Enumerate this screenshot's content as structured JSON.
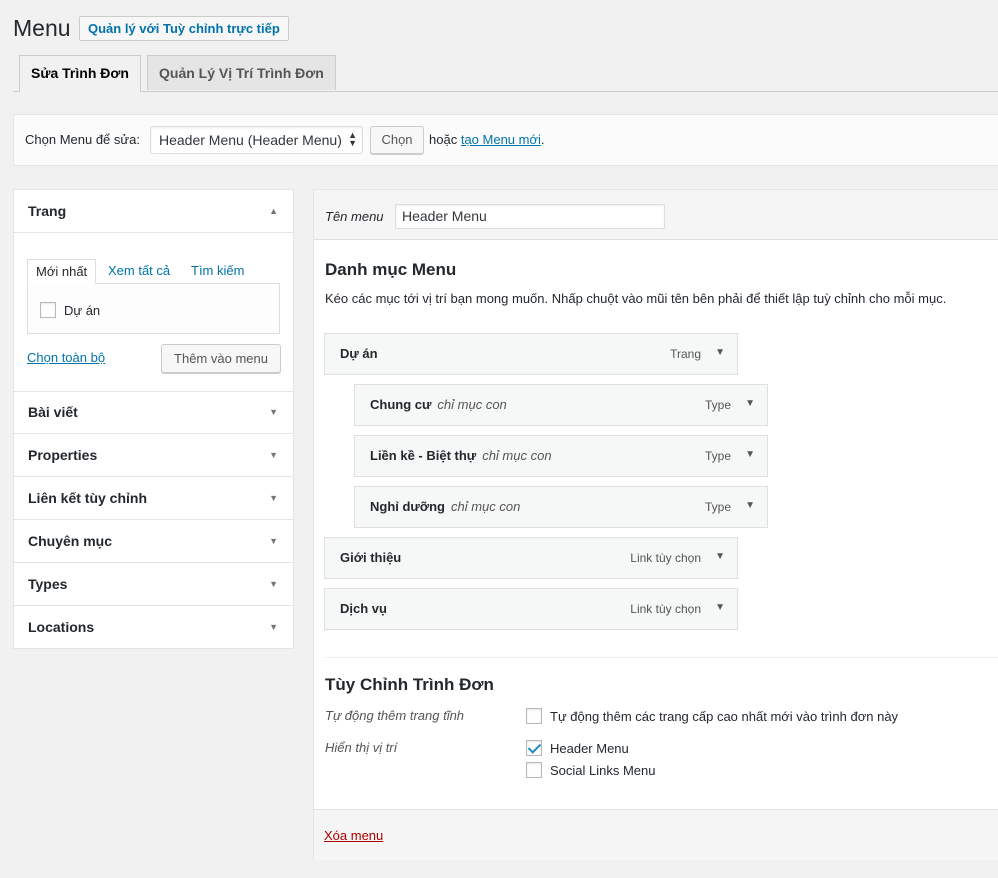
{
  "page": {
    "title": "Menu",
    "live_manage_button": "Quản lý với Tuỳ chỉnh trực tiếp"
  },
  "tabs": [
    {
      "label": "Sửa Trình Đơn",
      "active": true
    },
    {
      "label": "Quản Lý Vị Trí Trình Đơn",
      "active": false
    }
  ],
  "select_bar": {
    "label": "Chọn Menu để sửa:",
    "selected_menu": "Header Menu (Header Menu)",
    "choose_button": "Chọn",
    "or_text": "hoặc",
    "create_link": "tạo Menu mới",
    "period": "."
  },
  "sidebar": {
    "pages": {
      "title": "Trang",
      "subtabs": [
        "Mới nhất",
        "Xem tất cả",
        "Tìm kiếm"
      ],
      "items": [
        {
          "label": "Dự án",
          "checked": false
        }
      ],
      "select_all": "Chọn toàn bộ",
      "add_button": "Thêm vào menu"
    },
    "sections": [
      "Bài viết",
      "Properties",
      "Liên kết tùy chỉnh",
      "Chuyên mục",
      "Types",
      "Locations"
    ]
  },
  "main": {
    "name_label": "Tên menu",
    "name_value": "Header Menu",
    "structure_title": "Danh mục Menu",
    "structure_desc": "Kéo các mục tới vị trí bạn mong muốn. Nhấp chuột vào mũi tên bên phải để thiết lập tuỳ chỉnh cho mỗi mục.",
    "menu_items": [
      {
        "title": "Dự án",
        "sub": "",
        "type": "Trang",
        "depth": 0
      },
      {
        "title": "Chung cư",
        "sub": "chỉ mục con",
        "type": "Type",
        "depth": 1
      },
      {
        "title": "Liền kề - Biệt thự",
        "sub": "chỉ mục con",
        "type": "Type",
        "depth": 1
      },
      {
        "title": "Nghỉ dưỡng",
        "sub": "chỉ mục con",
        "type": "Type",
        "depth": 1
      },
      {
        "title": "Giới thiệu",
        "sub": "",
        "type": "Link tùy chọn",
        "depth": 0
      },
      {
        "title": "Dịch vụ",
        "sub": "",
        "type": "Link tùy chọn",
        "depth": 0
      }
    ],
    "settings_title": "Tùy Chỉnh Trình Đơn",
    "auto_add_label": "Tự động thêm trang tĩnh",
    "auto_add_option": {
      "label": "Tự động thêm các trang cấp cao nhất mới vào trình đơn này",
      "checked": false
    },
    "display_label": "Hiển thị vị trí",
    "locations": [
      {
        "label": "Header Menu",
        "checked": true
      },
      {
        "label": "Social Links Menu",
        "checked": false
      }
    ],
    "delete_link": "Xóa menu"
  },
  "icons": {
    "collapse": "▲",
    "expand": "▼",
    "select_arrows": "▲▼"
  },
  "colors": {
    "link": "#0073aa",
    "delete": "#a00000",
    "checkmark": "#1e8cbe"
  }
}
